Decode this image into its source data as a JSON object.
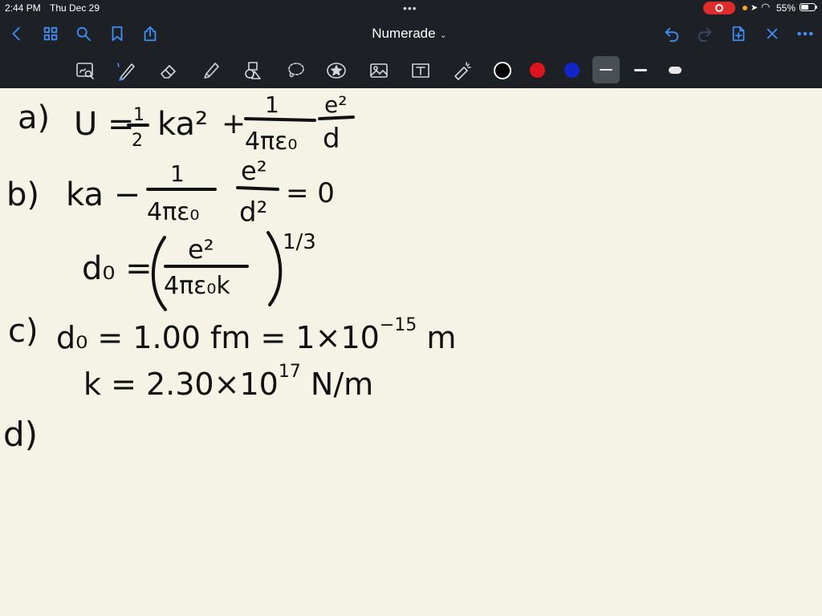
{
  "status": {
    "time": "2:44 PM",
    "date": "Thu Dec 29",
    "battery_pct": "55%",
    "battery_level": 0.55
  },
  "nav": {
    "title": "Numerade",
    "title_chevron": "⌄"
  },
  "toolbar": {
    "colors": {
      "black": "#000000",
      "red": "#e0141e",
      "blue": "#1226c8"
    }
  },
  "notes": {
    "a_label": "a)",
    "a_expr_left": "U = ",
    "a_half_num": "1",
    "a_half_den": "2",
    "a_ka2": "ka²",
    "a_plus": "+",
    "a_frac_num": "1",
    "a_frac_den": "4πε₀",
    "a_e2": "e²",
    "a_d": "d",
    "b_label": "b)",
    "b_ka": "ka −",
    "b_frac_num": "1",
    "b_frac_den": "4πε₀",
    "b_e2": "e²",
    "b_d2": "d²",
    "b_eq0": "= 0",
    "d0_lhs": "d₀ =",
    "d0_num": "e²",
    "d0_den": "4πε₀k",
    "d0_exp": "1/3",
    "c_label": "c)",
    "c_line1": "d₀ = 1.00 fm = 1×10",
    "c_line1_exp": "−15",
    "c_line1_unit": " m",
    "c_line2": "k = 2.30×10",
    "c_line2_exp": "17",
    "c_line2_unit": " N/m",
    "d_label": "d)"
  }
}
